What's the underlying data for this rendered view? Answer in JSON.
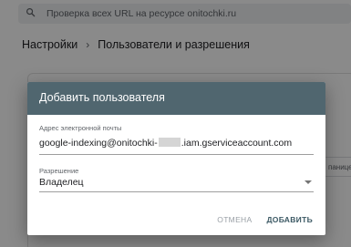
{
  "search": {
    "placeholder": "Проверка всех URL на ресурсе onitochki.ru"
  },
  "breadcrumb": {
    "parent": "Настройки",
    "separator": "›",
    "current": "Пользователи и разрешения"
  },
  "background": {
    "hint_text": "панице"
  },
  "dialog": {
    "title": "Добавить пользователя",
    "email": {
      "label": "Адрес электронной почты",
      "value_prefix": "google-indexing@onitochki-",
      "value_suffix": ".iam.gserviceaccount.com"
    },
    "permission": {
      "label": "Разрешение",
      "selected": "Владелец"
    },
    "buttons": {
      "cancel": "ОТМЕНА",
      "add": "ДОБАВИТЬ"
    }
  },
  "colors": {
    "header": "#50666f",
    "primary_action": "#3c5964",
    "scrim": "rgba(0,0,0,0.46)"
  }
}
